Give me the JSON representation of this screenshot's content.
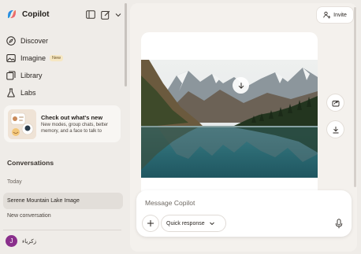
{
  "app": {
    "name": "Copilot"
  },
  "sidebar": {
    "nav": [
      {
        "label": "Discover",
        "icon": "compass-icon"
      },
      {
        "label": "Imagine",
        "icon": "image-icon",
        "badge": "New"
      },
      {
        "label": "Library",
        "icon": "library-icon"
      },
      {
        "label": "Labs",
        "icon": "flask-icon"
      }
    ],
    "promo": {
      "title": "Check out what's new",
      "body": "New modes, group chats, better memory, and a face to talk to"
    },
    "conversations_heading": "Conversations",
    "group_label": "Today",
    "conversations": [
      {
        "title": "Serene Mountain Lake Image",
        "selected": true
      },
      {
        "title": "New conversation",
        "selected": false
      }
    ],
    "user": {
      "initial": "J",
      "name": "زكرياء"
    }
  },
  "header": {
    "invite_label": "Invite"
  },
  "composer": {
    "placeholder": "Message Copilot",
    "mode": "Quick response"
  },
  "colors": {
    "avatar": "#8a2f8c",
    "background": "#efece8",
    "surface": "#ffffff"
  }
}
